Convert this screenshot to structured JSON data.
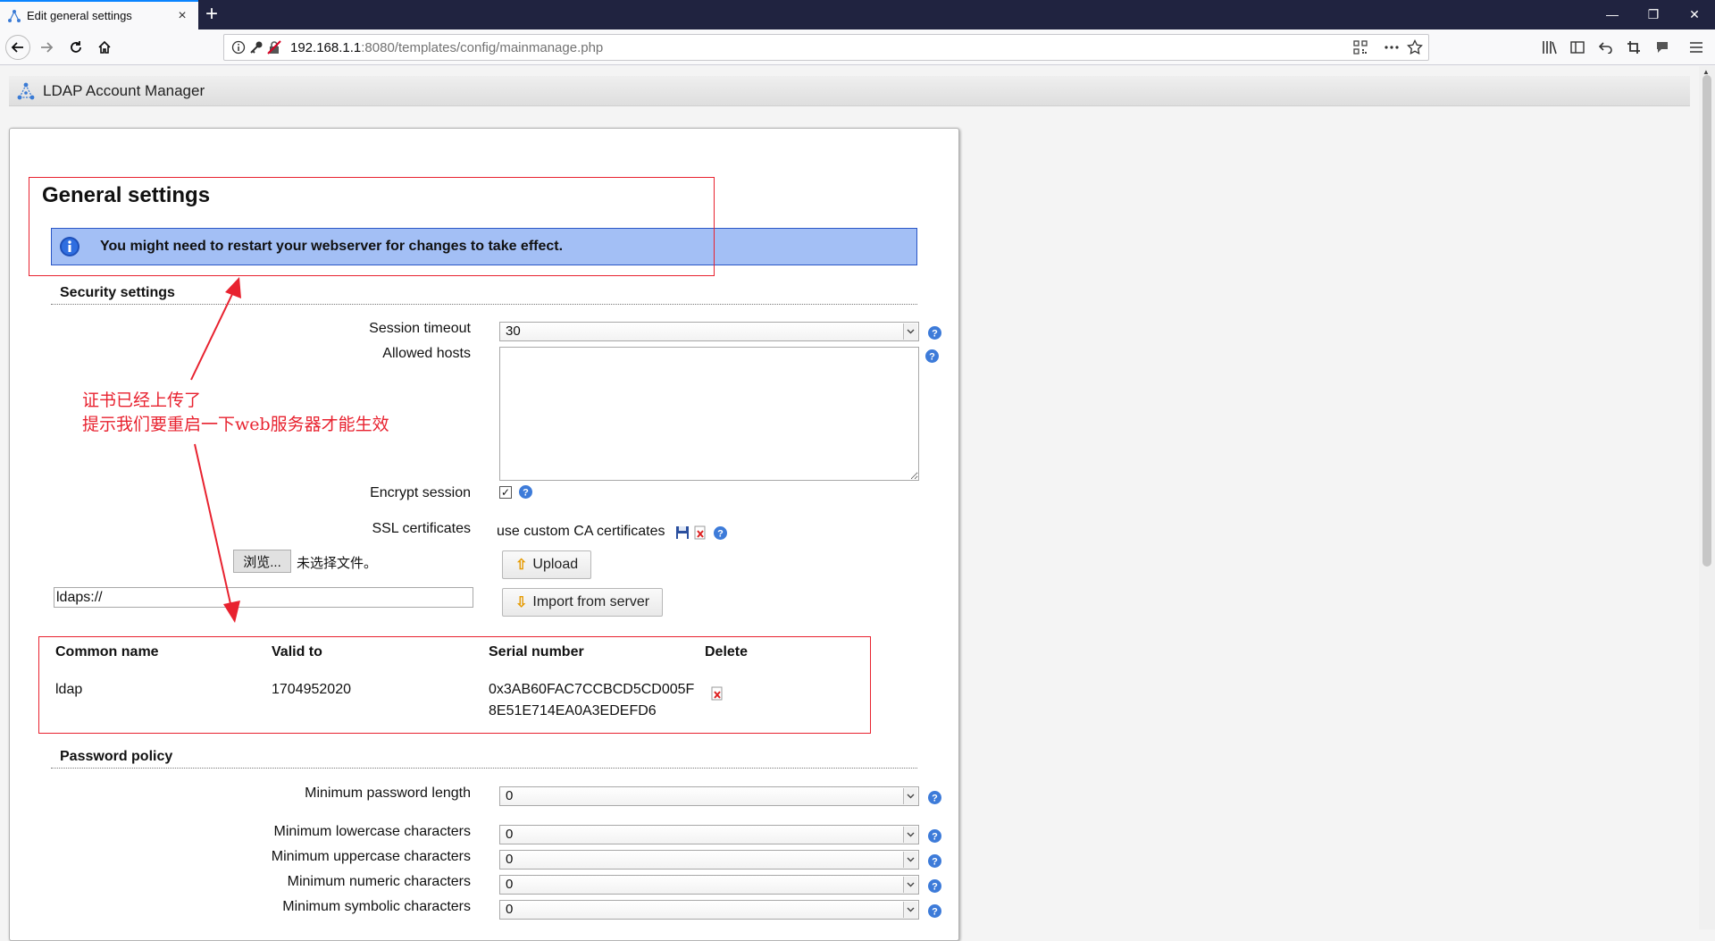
{
  "browser": {
    "tab_title": "Edit general settings",
    "tab_close": "×",
    "new_tab": "+",
    "url_host": "192.168.1.1",
    "url_rest": ":8080/templates/config/mainmanage.php",
    "window_controls": {
      "minimize": "—",
      "restore": "❐",
      "close": "✕"
    },
    "icons": [
      "back-icon",
      "forward-icon",
      "reload-icon",
      "home-icon",
      "info-icon",
      "key-icon",
      "insecure-lock-icon",
      "qr-code-icon",
      "more-actions-icon",
      "bookmark-star-icon",
      "library-icon",
      "sidebar-icon",
      "undo-icon",
      "crop-icon",
      "chat-icon",
      "menu-icon"
    ]
  },
  "app": {
    "name": "LDAP Account Manager"
  },
  "page": {
    "title": "General settings",
    "restart_message": "You might need to restart your webserver for changes to take effect.",
    "security": {
      "heading": "Security settings",
      "session_timeout_label": "Session timeout",
      "session_timeout_value": "30",
      "allowed_hosts_label": "Allowed hosts",
      "allowed_hosts_value": "",
      "encrypt_session_label": "Encrypt session",
      "encrypt_session_checked": true,
      "ssl_label": "SSL certificates",
      "ssl_value": "use custom CA certificates",
      "upload_label": "Upload",
      "import_label": "Import from server",
      "browse_label": "浏览...",
      "file_status": "未选择文件。",
      "server_url_value": "ldaps://"
    },
    "cert_table": {
      "headers": [
        "Common name",
        "Valid to",
        "Serial number",
        "Delete"
      ],
      "rows": [
        {
          "common_name": "ldap",
          "valid_to": "1704952020",
          "serial_line1": "0x3AB60FAC7CCBCD5CD005F",
          "serial_line2": "8E51E714EA0A3EDEFD6"
        }
      ]
    },
    "password_policy": {
      "heading": "Password policy",
      "fields": [
        {
          "label": "Minimum password length",
          "value": "0"
        },
        {
          "label": "Minimum lowercase characters",
          "value": "0"
        },
        {
          "label": "Minimum uppercase characters",
          "value": "0"
        },
        {
          "label": "Minimum numeric characters",
          "value": "0"
        },
        {
          "label": "Minimum symbolic characters",
          "value": "0"
        }
      ]
    }
  },
  "annotation": {
    "line1": "证书已经上传了",
    "line2": "提示我们要重启一下web服务器才能生效",
    "color": "#e8222f"
  },
  "colors": {
    "message_bg": "#a3bff5",
    "message_border": "#2a56c6",
    "tab_accent": "#0a84ff",
    "help_icon": "#3d7bd9"
  }
}
